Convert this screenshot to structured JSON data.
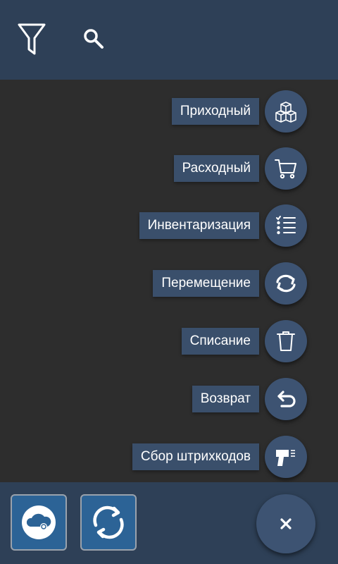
{
  "toolbar": {
    "icons": [
      "filter-icon",
      "search-icon"
    ]
  },
  "menu": {
    "items": [
      {
        "label": "Приходный",
        "icon": "boxes-icon"
      },
      {
        "label": "Расходный",
        "icon": "cart-icon"
      },
      {
        "label": "Инвентаризация",
        "icon": "checklist-icon"
      },
      {
        "label": "Перемещение",
        "icon": "swap-arrows-icon"
      },
      {
        "label": "Списание",
        "icon": "trash-icon"
      },
      {
        "label": "Возврат",
        "icon": "return-arrow-icon"
      },
      {
        "label": "Сбор штрихкодов",
        "icon": "barcode-scanner-icon"
      }
    ]
  },
  "bottom": {
    "buttons": [
      "cloud-sync-icon",
      "refresh-icon",
      "close-icon"
    ]
  },
  "colors": {
    "bar": "#2e4057",
    "background": "#2d2d2d",
    "fab": "#3d5372",
    "label": "#3a4f6b",
    "square_button": "#2c6396"
  }
}
